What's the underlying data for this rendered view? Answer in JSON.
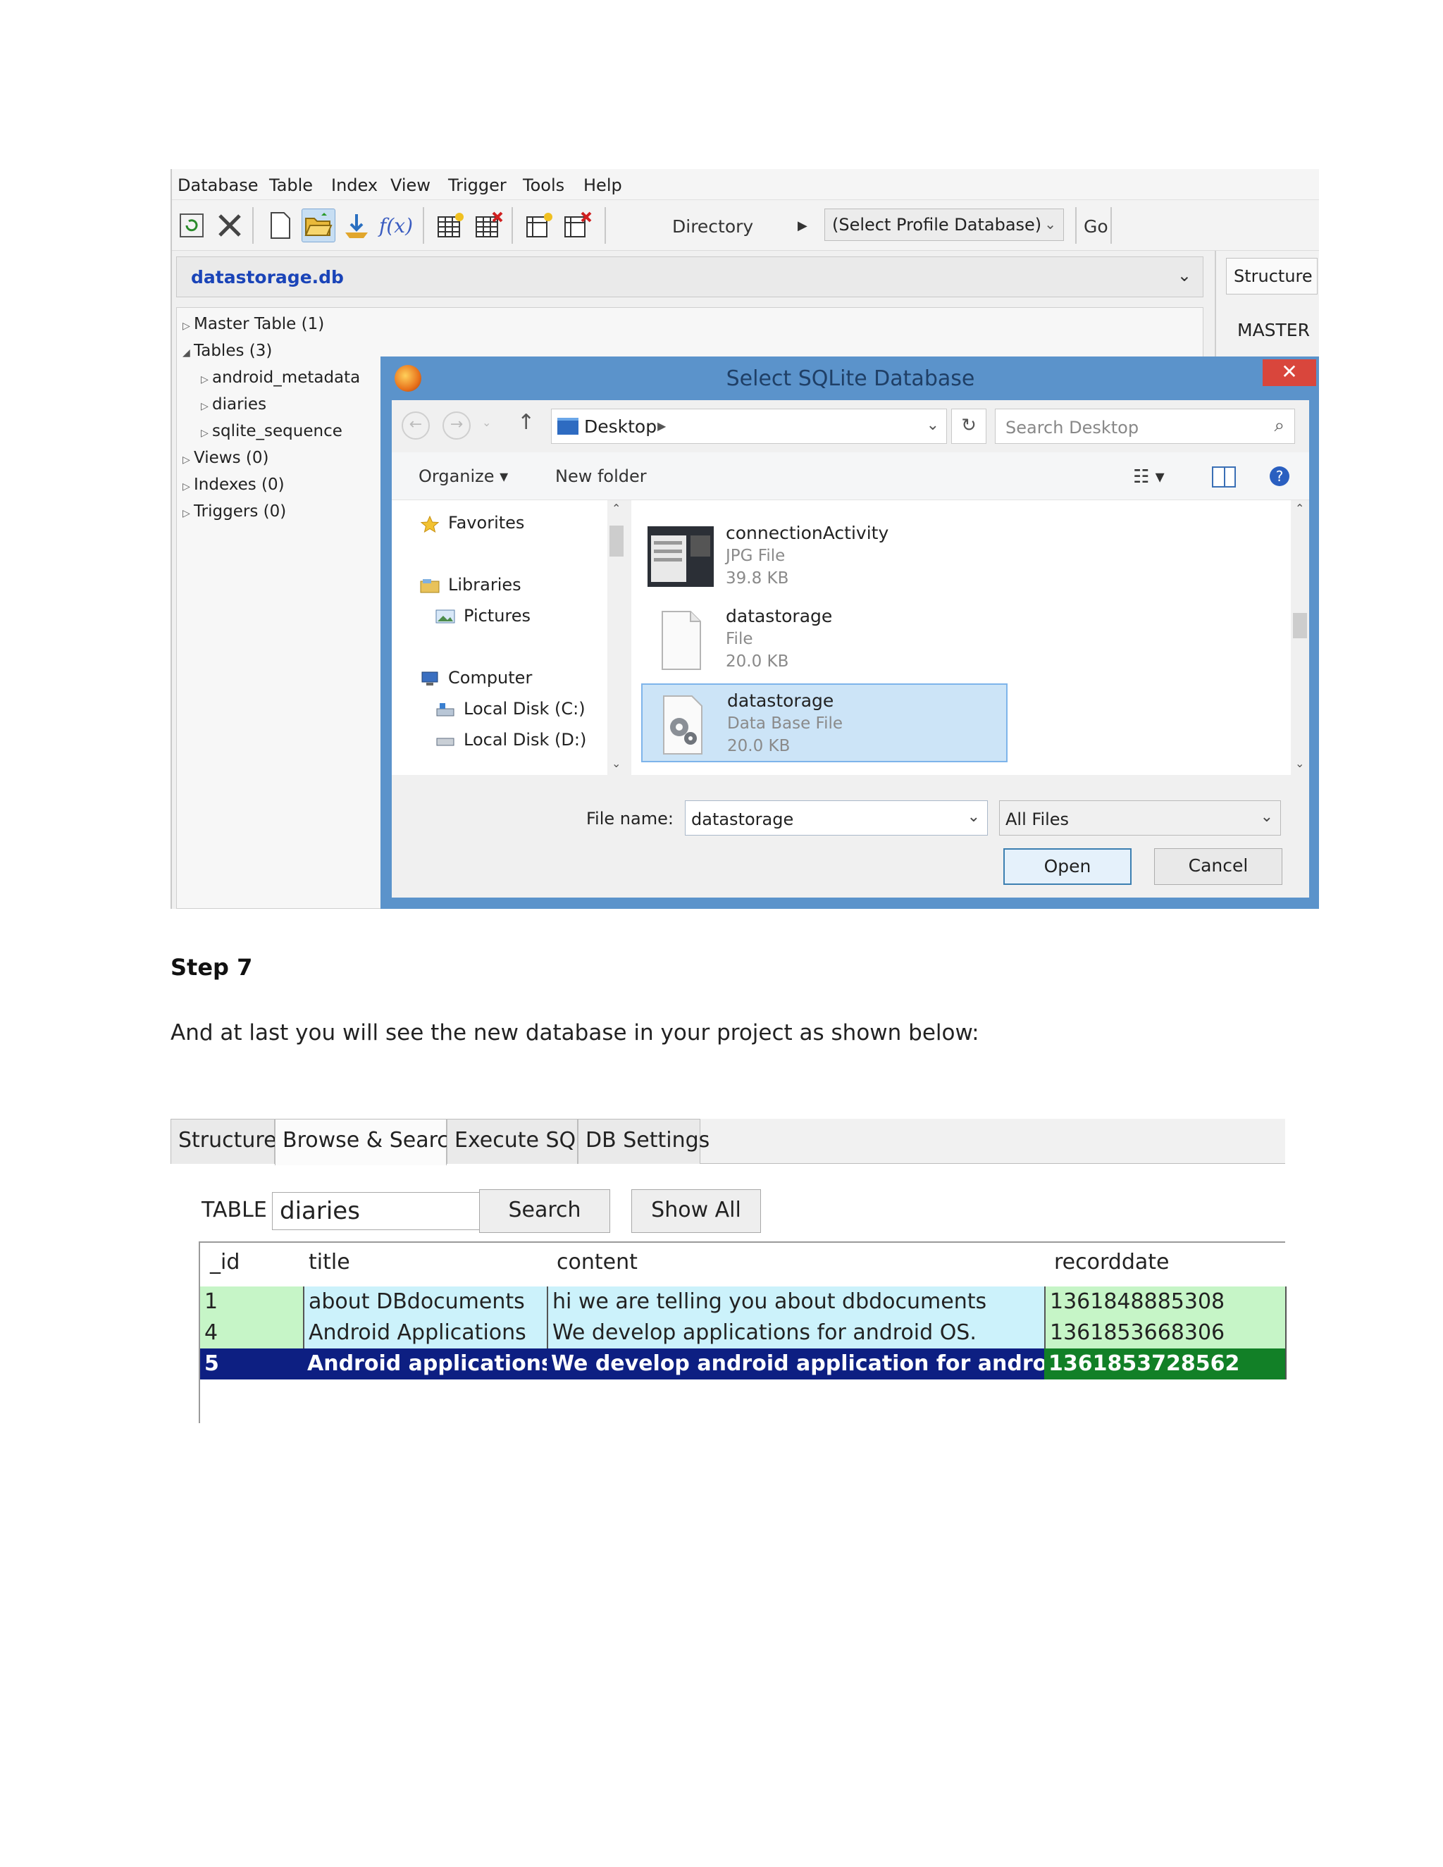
{
  "app": {
    "menu": [
      "Database",
      "Table",
      "Index",
      "View",
      "Trigger",
      "Tools",
      "Help"
    ],
    "toolbar": {
      "icons": [
        "refresh-db-icon",
        "tools-icon",
        "new-db-icon",
        "open-db-icon",
        "import-icon",
        "function-icon",
        "create-table-icon",
        "drop-table-icon",
        "create-index-icon",
        "drop-index-icon"
      ],
      "fx_label": "f(x)",
      "directory_label": "Directory",
      "profile_combo": "(Select Profile Database)",
      "go_label": "Go"
    },
    "db_combo": "datastorage.db",
    "structure_tab": "Structure",
    "master_label": "MASTER",
    "tree": {
      "master_table": "Master Table (1)",
      "tables": "Tables (3)",
      "table_items": [
        "android_metadata",
        "diaries",
        "sqlite_sequence"
      ],
      "views": "Views (0)",
      "indexes": "Indexes (0)",
      "triggers": "Triggers (0)"
    }
  },
  "dialog": {
    "title": "Select SQLite Database",
    "close": "✕",
    "address": "Desktop",
    "search_placeholder": "Search Desktop",
    "organize": "Organize ▾",
    "new_folder": "New folder",
    "nav": {
      "favorites": "Favorites",
      "libraries": "Libraries",
      "pictures": "Pictures",
      "computer": "Computer",
      "local_c": "Local Disk (C:)",
      "local_d": "Local Disk (D:)"
    },
    "files": [
      {
        "name": "connectionActivity",
        "type": "JPG File",
        "size": "39.8 KB"
      },
      {
        "name": "datastorage",
        "type": "File",
        "size": "20.0 KB"
      },
      {
        "name": "datastorage",
        "type": "Data Base File",
        "size": "20.0 KB"
      }
    ],
    "file_name_label": "File name:",
    "file_name_value": "datastorage",
    "filter_value": "All Files",
    "open": "Open",
    "cancel": "Cancel"
  },
  "text": {
    "step": "Step 7",
    "paragraph": "And at last you will see the new database in your project as shown below:"
  },
  "browser": {
    "tabs": [
      "Structure",
      "Browse & Search",
      "Execute SQL",
      "DB Settings"
    ],
    "table_label": "TABLE",
    "table_value": "diaries",
    "search_btn": "Search",
    "show_all_btn": "Show All",
    "columns": [
      "_id",
      "title",
      "content",
      "recorddate"
    ],
    "rows": [
      [
        "1",
        "about DBdocuments",
        "hi we are telling you about dbdocuments",
        "1361848885308"
      ],
      [
        "4",
        "Android Applications",
        "We develop applications for android OS.",
        "1361853668306"
      ],
      [
        "5",
        "Android applications",
        "We develop android application for android OS",
        "1361853728562"
      ]
    ]
  }
}
